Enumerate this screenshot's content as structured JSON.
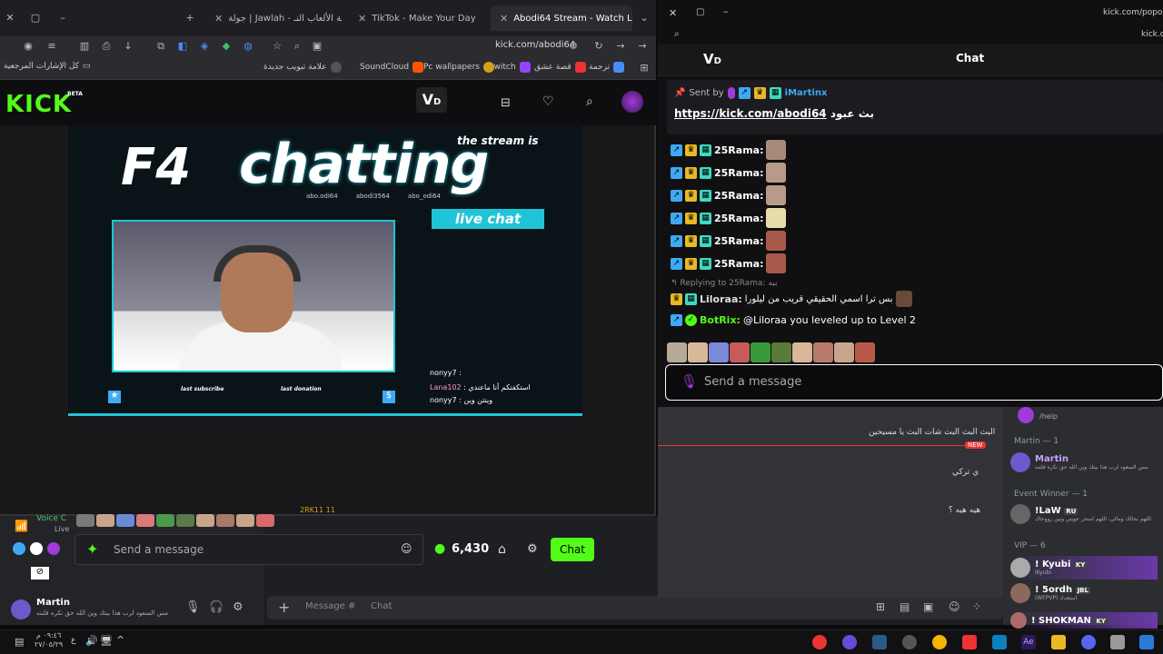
{
  "browser": {
    "tabs": [
      {
        "label": "جولة | Jawlah - منصة الألعاب النـ"
      },
      {
        "label": "TikTok - Make Your Day"
      },
      {
        "label": "Abodi64 Stream - Watch Live o"
      }
    ],
    "url": "kick.com/abodi64",
    "bookmarks": [
      "ترجمة",
      "قصة عشق",
      "twitch",
      "Pc wallpapers",
      "SoundCloud",
      "علامة تبويب جديدة",
      "كل الإشارات المرجعية"
    ]
  },
  "kick": {
    "logo": "KICK",
    "beta": "BETA",
    "stream_overlay": {
      "title": "chatting",
      "subtitle": "the stream is",
      "live_chat": "live chat",
      "last_subscribe": "last subscribe",
      "last_donation": "last donation",
      "handles": [
        "abo.odi64",
        "abodi3564",
        "abo_odi64"
      ],
      "chat_lines": [
        {
          "user": "nonyy7",
          "text": ":"
        },
        {
          "user": "Lana102",
          "text": ": استكفتكم أنا ماعندي"
        },
        {
          "user": "nonyy7",
          "text": ": وينتن وين"
        }
      ]
    }
  },
  "discord": {
    "voice_label": "Voice C",
    "live_label": "Live",
    "user_name": "Martin",
    "user_status": "مس السعود لرب هذا بيتك وين الله حق نكره فلتنه",
    "chat_placeholder": "Message #",
    "chat_channel": "Chat",
    "viewer_count": "2RK11 11",
    "kick_message_placeholder": "Send a message",
    "points": "6,430",
    "chat_button": "Chat",
    "main_messages": [
      "البث البث البث شات البث يا مسيحين",
      "NEW",
      "ي تركي",
      "هيه هيه ؟"
    ],
    "members": {
      "help_label": "/help",
      "section_martin": "Martin — 1",
      "section_event": "Event Winner — 1",
      "section_vip": "VIP — 6",
      "list": [
        {
          "name": "Martin",
          "status": "مس السعود لرب هذا بيتك وين الله حق نكره فلتنه",
          "tag": ""
        },
        {
          "name": "!LaW",
          "status": "اللهم بحالك ومالي، اللهم اسحر عويني وبين رووحاك",
          "tag": "RU"
        },
        {
          "name": "! Kyubi",
          "status": "iKyubi",
          "tag": "KY"
        },
        {
          "name": "! 5ordh",
          "status": "(WFPVP) استعداد",
          "tag": "JBL"
        },
        {
          "name": "! SHOKMAN",
          "status": "",
          "tag": "KY"
        }
      ]
    }
  },
  "popout": {
    "url": "kick.com/popout/",
    "url2": "kick.com",
    "header": "Chat",
    "pinned": {
      "sent_by_label": "Sent by",
      "sender": "iMartinx",
      "link": "https://kick.com/abodi64",
      "text": "بث عبود"
    },
    "messages": [
      {
        "user": "25Rama:"
      },
      {
        "user": "25Rama:"
      },
      {
        "user": "25Rama:"
      },
      {
        "user": "25Rama:"
      },
      {
        "user": "25Rama:"
      },
      {
        "user": "25Rama:"
      }
    ],
    "reply": {
      "replying_to": "Replying to 25Rama:",
      "reply_snippet": "ببه",
      "user": "Liloraa:",
      "text": "بس ترا اسمي الحقيقي قريب من ليلورا"
    },
    "bot": {
      "user": "BotRix:",
      "text": "@Liloraa you leveled up to Level 2"
    },
    "send_placeholder": "Send a message"
  },
  "taskbar": {
    "time": "٠٩:٤٦ م",
    "date": "٢٧/٠٥/٢٩",
    "lang": "ع"
  }
}
